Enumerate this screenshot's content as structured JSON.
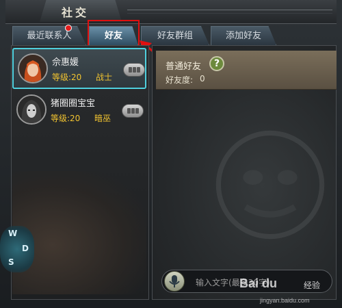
{
  "window": {
    "title": "社交"
  },
  "tabs": [
    {
      "label": "最近联系人",
      "has_notification": true
    },
    {
      "label": "好友",
      "active": true
    },
    {
      "label": "好友群组"
    },
    {
      "label": "添加好友"
    }
  ],
  "friends": [
    {
      "name": "佘惠媛",
      "level": "等级:20",
      "class": "战士",
      "selected": true
    },
    {
      "name": "猪圈圈宝宝",
      "level": "等级:20",
      "class": "暗巫",
      "selected": false
    }
  ],
  "group": {
    "title": "普通好友",
    "intimacy_label": "好友度:",
    "intimacy_value": "0"
  },
  "chat_input": {
    "placeholder": "输入文字(最多30字)"
  },
  "dpad": {
    "up": "W",
    "right": "D",
    "down": "S"
  },
  "watermark": {
    "logo": "Bai du",
    "product": "经验",
    "url": "jingyan.baidu.com"
  },
  "colors": {
    "selected_border": "#4fd0de",
    "highlight_box": "#e01010",
    "level_text": "#f2c430",
    "notification_dot": "#e31c1c"
  }
}
